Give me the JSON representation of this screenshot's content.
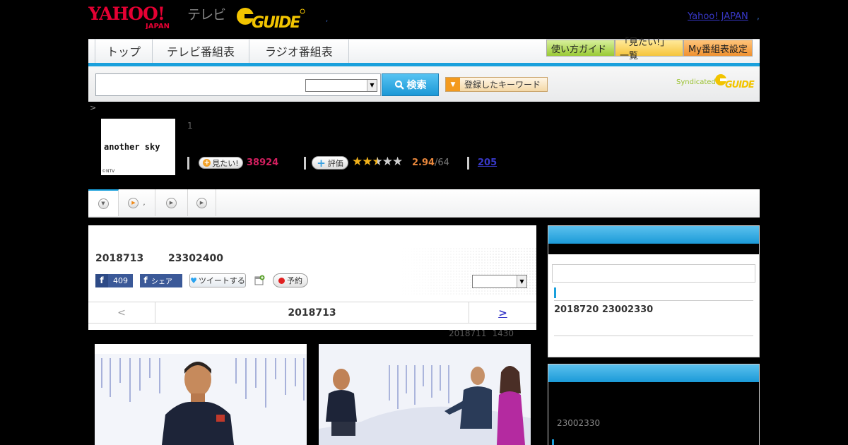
{
  "header": {
    "tv_label": "テレビ",
    "yahoo_japan_link": "Yahoo! JAPAN"
  },
  "nav": {
    "tabs": [
      "トップ",
      "テレビ番組表",
      "ラジオ番組表"
    ],
    "buttons": [
      "使い方ガイド",
      "「見たい!」一覧",
      "My番組表設定"
    ]
  },
  "search": {
    "input_value": "",
    "select_value": "",
    "search_button": "検索",
    "keyword_button": "登録したキーワード",
    "syndicated": "Syndicated"
  },
  "breadcrumb": {
    "separator": ">"
  },
  "program": {
    "thumbnail_title": "another sky",
    "thumbnail_credit": "©NTV",
    "episode_number": "1",
    "watch_button": "見たい!",
    "watch_count": "38924",
    "rate_button": "評価",
    "rating_value": "2.94",
    "rating_count": "/64",
    "rating_stars": 2.5,
    "review_count": "205"
  },
  "main": {
    "broadcast_date": "2018713",
    "broadcast_time": "23302400",
    "facebook_count": "409",
    "facebook_share": "シェア",
    "tweet": "ツイートする",
    "reserve": "予約",
    "date_prev": "<",
    "date_current": "2018713",
    "date_next": ">",
    "updated_date": "2018711",
    "updated_time": "1430"
  },
  "sidebar": {
    "search_value": "",
    "schedule": "2018720  23002330",
    "second_time": "23002330"
  },
  "colors": {
    "accent_blue": "#1aa0dc",
    "watch_pink": "#d21f5f",
    "rating_orange": "#e9873c",
    "link_blue": "#3838c8"
  }
}
